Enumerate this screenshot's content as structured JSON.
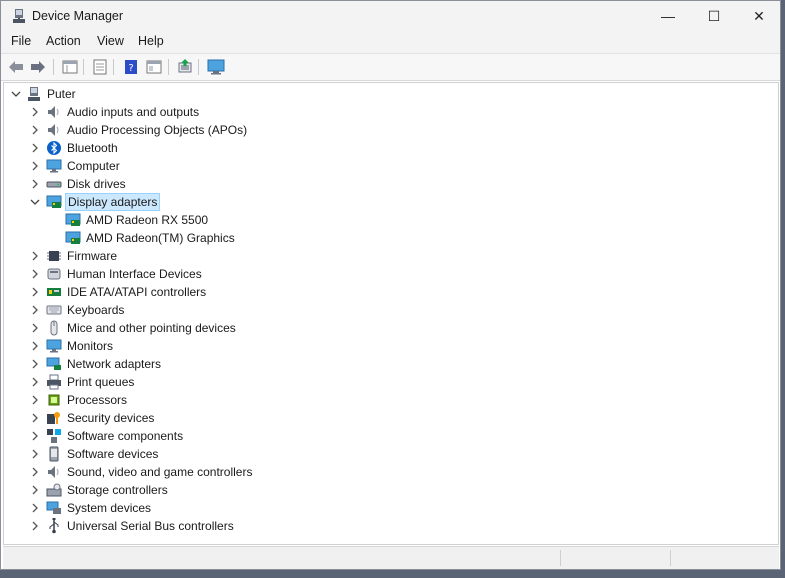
{
  "window": {
    "title": "Device Manager"
  },
  "window_controls": {
    "minimize": "—",
    "maximize": "☐",
    "close": "✕"
  },
  "menu": [
    "File",
    "Action",
    "View",
    "Help"
  ],
  "toolbar": [
    "back-icon",
    "forward-icon",
    "properties-view-icon",
    "show-hidden-icon",
    "help-icon",
    "details-icon",
    "update-driver-icon",
    "monitor-scan-icon"
  ],
  "tree": {
    "root": "Puter",
    "items": [
      {
        "label": "Audio inputs and outputs",
        "icon": "speaker-icon",
        "expanded": false
      },
      {
        "label": "Audio Processing Objects (APOs)",
        "icon": "speaker-icon",
        "expanded": false
      },
      {
        "label": "Bluetooth",
        "icon": "bluetooth-icon",
        "expanded": false
      },
      {
        "label": "Computer",
        "icon": "monitor-icon",
        "expanded": false
      },
      {
        "label": "Disk drives",
        "icon": "disk-icon",
        "expanded": false
      },
      {
        "label": "Display adapters",
        "icon": "display-adapter-icon",
        "expanded": true,
        "selected": true,
        "children": [
          "AMD Radeon RX 5500",
          "AMD Radeon(TM) Graphics"
        ]
      },
      {
        "label": "Firmware",
        "icon": "chip-icon",
        "expanded": false
      },
      {
        "label": "Human Interface Devices",
        "icon": "hid-icon",
        "expanded": false
      },
      {
        "label": "IDE ATA/ATAPI controllers",
        "icon": "controller-icon",
        "expanded": false
      },
      {
        "label": "Keyboards",
        "icon": "keyboard-icon",
        "expanded": false
      },
      {
        "label": "Mice and other pointing devices",
        "icon": "mouse-icon",
        "expanded": false
      },
      {
        "label": "Monitors",
        "icon": "monitor-icon",
        "expanded": false
      },
      {
        "label": "Network adapters",
        "icon": "network-icon",
        "expanded": false
      },
      {
        "label": "Print queues",
        "icon": "printer-icon",
        "expanded": false
      },
      {
        "label": "Processors",
        "icon": "processor-icon",
        "expanded": false
      },
      {
        "label": "Security devices",
        "icon": "security-icon",
        "expanded": false
      },
      {
        "label": "Software components",
        "icon": "software-component-icon",
        "expanded": false
      },
      {
        "label": "Software devices",
        "icon": "software-device-icon",
        "expanded": false
      },
      {
        "label": "Sound, video and game controllers",
        "icon": "speaker-icon",
        "expanded": false
      },
      {
        "label": "Storage controllers",
        "icon": "storage-icon",
        "expanded": false
      },
      {
        "label": "System devices",
        "icon": "system-icon",
        "expanded": false
      },
      {
        "label": "Universal Serial Bus controllers",
        "icon": "usb-icon",
        "expanded": false
      }
    ]
  },
  "colors": {
    "selection_bg": "#cce8ff",
    "selection_border": "#99d1ff",
    "accent": "#0078d4"
  }
}
